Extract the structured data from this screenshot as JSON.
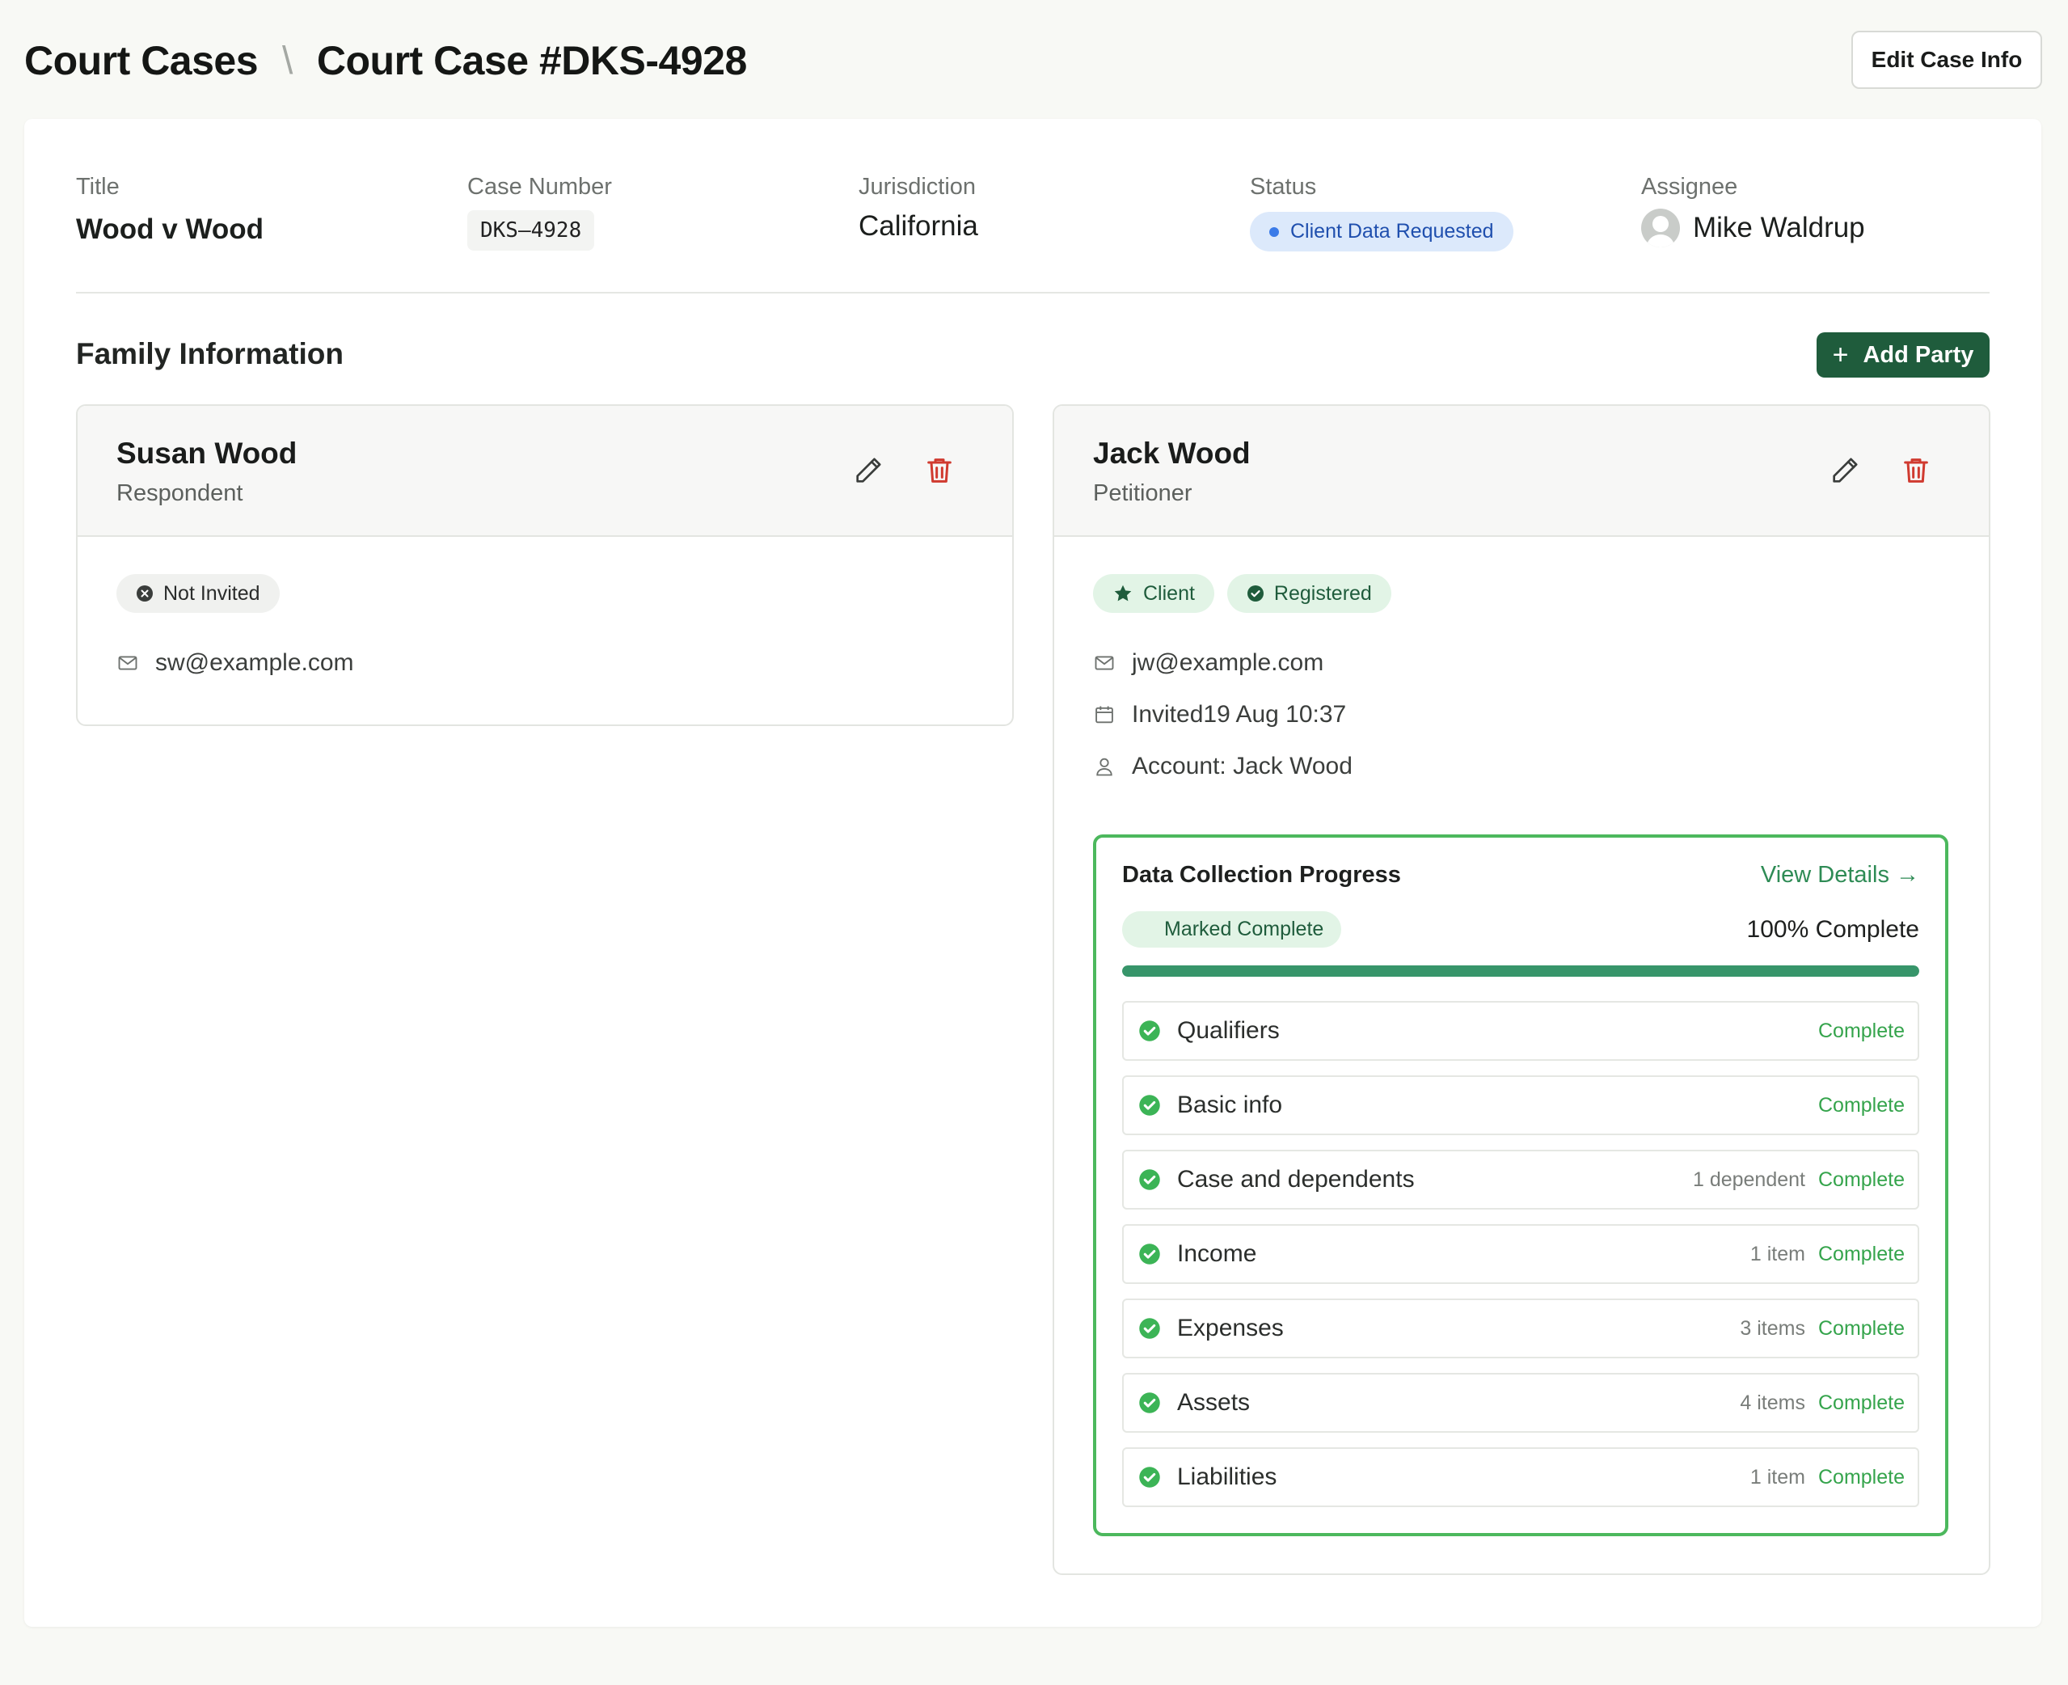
{
  "header": {
    "breadcrumb_root": "Court Cases",
    "breadcrumb_sep": "\\",
    "breadcrumb_current": "Court Case #DKS-4928",
    "edit_button": "Edit Case Info"
  },
  "case": {
    "title_label": "Title",
    "title_value": "Wood v Wood",
    "number_label": "Case Number",
    "number_value": "DKS–4928",
    "jurisdiction_label": "Jurisdiction",
    "jurisdiction_value": "California",
    "status_label": "Status",
    "status_value": "Client Data Requested",
    "assignee_label": "Assignee",
    "assignee_value": "Mike Waldrup"
  },
  "family": {
    "title": "Family Information",
    "add_button": "Add Party"
  },
  "parties": [
    {
      "name": "Susan Wood",
      "role": "Respondent",
      "tags": [
        "Not Invited"
      ],
      "email": "sw@example.com"
    },
    {
      "name": "Jack Wood",
      "role": "Petitioner",
      "tags": [
        "Client",
        "Registered"
      ],
      "email": "jw@example.com",
      "invited": "Invited19 Aug 10:37",
      "account": "Account: Jack Wood",
      "progress": {
        "title": "Data Collection Progress",
        "link": "View Details →",
        "chip": "Marked Complete",
        "percent_label": "100% Complete",
        "percent": 100,
        "steps": [
          {
            "label": "Qualifiers",
            "count": "",
            "status": "Complete"
          },
          {
            "label": "Basic info",
            "count": "",
            "status": "Complete"
          },
          {
            "label": "Case and dependents",
            "count": "1 dependent",
            "status": "Complete"
          },
          {
            "label": "Income",
            "count": "1 item",
            "status": "Complete"
          },
          {
            "label": "Expenses",
            "count": "3 items",
            "status": "Complete"
          },
          {
            "label": "Assets",
            "count": "4 items",
            "status": "Complete"
          },
          {
            "label": "Liabilities",
            "count": "1 item",
            "status": "Complete"
          }
        ]
      }
    }
  ],
  "colors": {
    "accent_green": "#1f5c3c",
    "complete_green": "#35a44c",
    "status_blue": "#3b7be8",
    "delete_red": "#d03a2f"
  }
}
